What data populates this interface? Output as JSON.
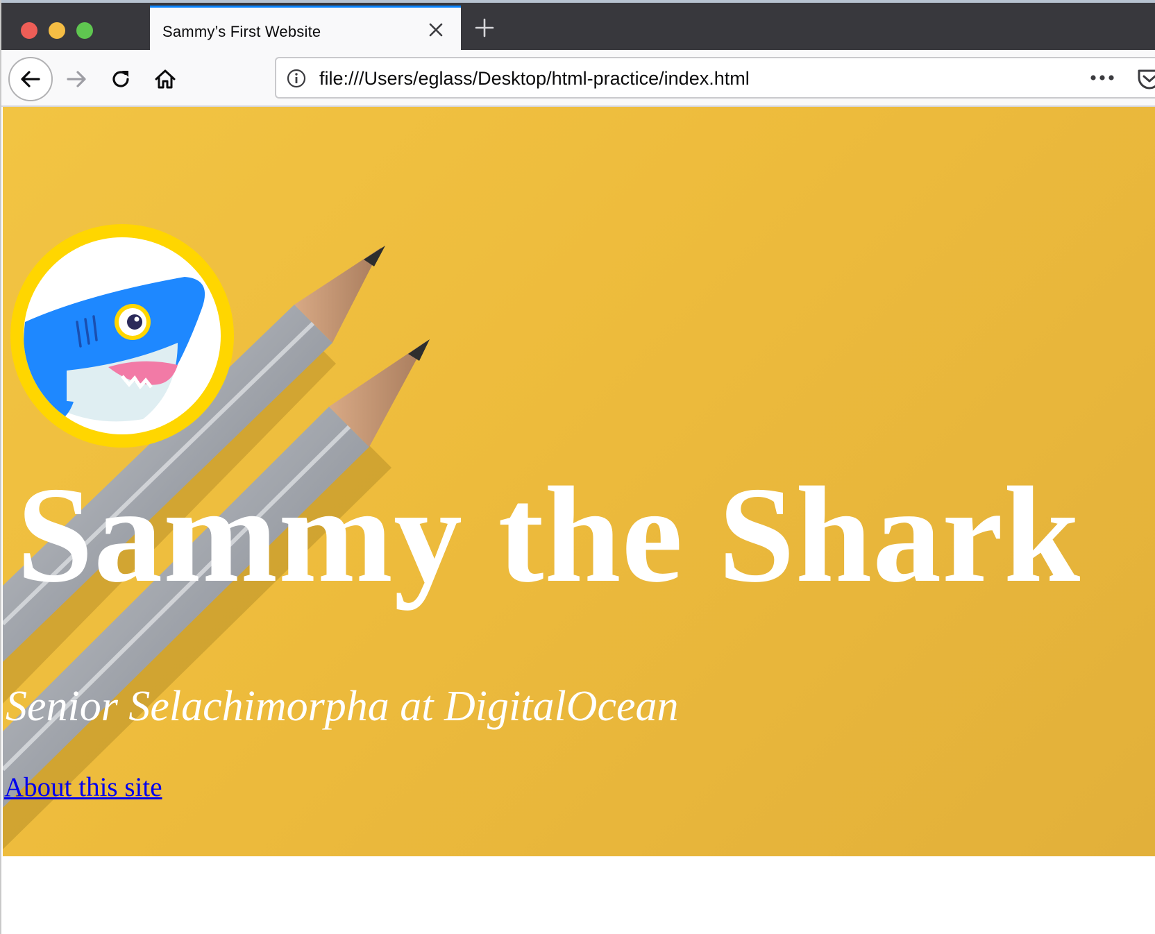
{
  "browser": {
    "tab": {
      "title": "Sammy’s First Website"
    },
    "url": "file:///Users/eglass/Desktop/html-practice/index.html",
    "icons": {
      "close_tab": "close-icon",
      "new_tab": "plus-icon",
      "back": "back-arrow-icon",
      "forward": "forward-arrow-icon",
      "reload": "reload-icon",
      "home": "home-icon",
      "site_info": "info-icon",
      "page_actions": "more-icon",
      "pocket": "pocket-icon"
    },
    "colors": {
      "tab_strip": "#38383d",
      "active_tab_accent": "#0a84ff",
      "toolbar": "#f9f9fa"
    }
  },
  "page": {
    "hero": {
      "title": "Sammy the Shark",
      "subtitle": "Senior Selachimorpha at DigitalOcean",
      "link_label": "About this site",
      "background_color": "#f0c040",
      "avatar_ring_color": "#ffd600"
    }
  }
}
